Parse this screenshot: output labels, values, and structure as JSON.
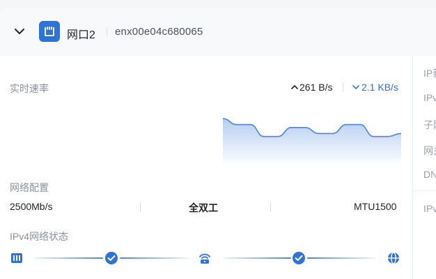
{
  "header": {
    "port_name": "网口2",
    "interface": "enx00e04c680065",
    "accent": "#2f73d9"
  },
  "speed": {
    "label": "实时速率",
    "up": "261 B/s",
    "down": "2.1 KB/s",
    "chart_data": {
      "type": "area",
      "values": [
        7,
        5,
        5,
        1,
        1,
        4,
        4,
        2,
        2,
        5,
        5,
        1,
        1,
        2
      ]
    }
  },
  "config": {
    "label": "网络配置",
    "speed": "2500Mb/s",
    "duplex": "全双工",
    "mtu": "MTU1500"
  },
  "ipv4_status": {
    "label": "IPv4网络状态",
    "steps": [
      "port-icon",
      "check-icon",
      "router-icon",
      "check-icon",
      "globe-icon"
    ]
  },
  "right_pane": {
    "items": [
      "IP获",
      "IPv",
      "子网",
      "网关",
      "DN",
      "IPv"
    ]
  }
}
